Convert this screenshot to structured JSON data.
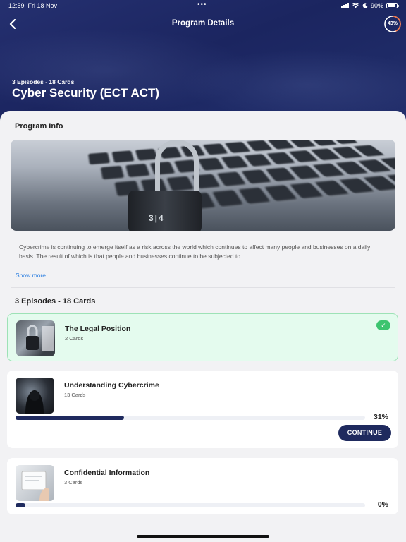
{
  "status_bar": {
    "time": "12:59",
    "date": "Fri 18 Nov",
    "battery": "90%",
    "battery_level": 0.9
  },
  "header": {
    "title": "Program Details",
    "progress_label": "43%",
    "progress": 0.43
  },
  "hero": {
    "subtitle": "3 Episodes - 18 Cards",
    "title": "Cyber Security (ECT ACT)"
  },
  "program_info": {
    "heading": "Program Info",
    "image_text": "3|4",
    "description": "Cybercrime is continuing to emerge itself as a risk across the world which continues to affect many people and businesses on a daily basis. The result of which is that people and businesses continue to be subjected to...",
    "show_more": "Show more"
  },
  "episodes": {
    "heading": "3 Episodes - 18 Cards",
    "items": [
      {
        "title": "The Legal Position",
        "cards": "2 Cards",
        "completed": true
      },
      {
        "title": "Understanding Cybercrime",
        "cards": "13 Cards",
        "progress_label": "31%",
        "progress": 0.31,
        "action": "CONTINUE"
      },
      {
        "title": "Confidential Information",
        "cards": "3 Cards",
        "progress_label": "0%",
        "progress": 0.0
      }
    ]
  },
  "colors": {
    "navy": "#1f2a5e",
    "accent_ring": "#e8734a",
    "complete_green": "#3cc46f",
    "link": "#2a7ee0"
  },
  "icons": [
    "back-chevron-icon",
    "wifi-icon",
    "moon-icon",
    "battery-icon",
    "checkmark-icon"
  ]
}
